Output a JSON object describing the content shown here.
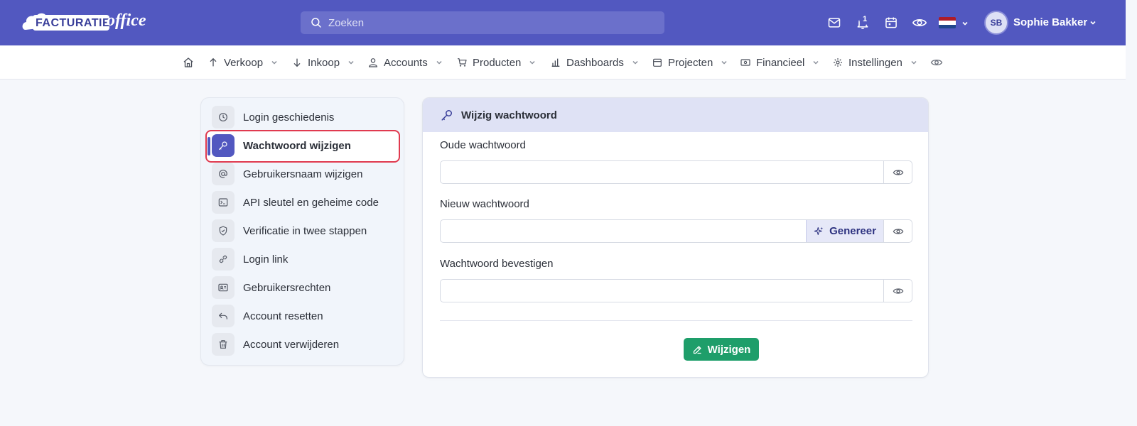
{
  "header": {
    "logo_text": "FACTURATIE",
    "logo_office": "office",
    "search_placeholder": "Zoeken",
    "notification_count": "1",
    "user_initials": "SB",
    "user_name": "Sophie Bakker"
  },
  "nav": {
    "items": [
      {
        "label": "Verkoop",
        "icon": "arrow-up-icon"
      },
      {
        "label": "Inkoop",
        "icon": "arrow-down-icon"
      },
      {
        "label": "Accounts",
        "icon": "user-icon"
      },
      {
        "label": "Producten",
        "icon": "cart-icon"
      },
      {
        "label": "Dashboards",
        "icon": "bar-chart-icon"
      },
      {
        "label": "Projecten",
        "icon": "calendar-icon"
      },
      {
        "label": "Financieel",
        "icon": "money-icon"
      },
      {
        "label": "Instellingen",
        "icon": "gear-icon"
      }
    ]
  },
  "sidebar": {
    "items": [
      {
        "label": "Login geschiedenis",
        "icon": "clock-icon"
      },
      {
        "label": "Wachtwoord wijzigen",
        "icon": "key-icon",
        "active": true
      },
      {
        "label": "Gebruikersnaam wijzigen",
        "icon": "at-icon"
      },
      {
        "label": "API sleutel en geheime code",
        "icon": "terminal-icon"
      },
      {
        "label": "Verificatie in twee stappen",
        "icon": "shield-icon"
      },
      {
        "label": "Login link",
        "icon": "link-icon"
      },
      {
        "label": "Gebruikersrechten",
        "icon": "id-card-icon"
      },
      {
        "label": "Account resetten",
        "icon": "undo-icon"
      },
      {
        "label": "Account verwijderen",
        "icon": "trash-icon"
      }
    ]
  },
  "panel": {
    "title": "Wijzig wachtwoord",
    "old_password_label": "Oude wachtwoord",
    "old_password_value": "",
    "new_password_label": "Nieuw wachtwoord",
    "new_password_value": "",
    "generate_label": "Genereer",
    "confirm_password_label": "Wachtwoord bevestigen",
    "confirm_password_value": "",
    "submit_label": "Wijzigen"
  },
  "colors": {
    "brand": "#5258c0",
    "submit": "#1e9e6a",
    "highlight": "#e03a4f"
  }
}
